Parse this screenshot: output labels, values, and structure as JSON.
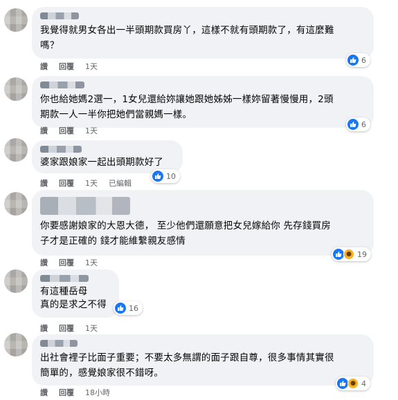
{
  "comments": [
    {
      "text": "我覺得就男女各出一半頭期款買房丫，這樣不就有頭期款了，有這麼難\n嗎？",
      "actions": [
        "讚",
        "回覆",
        "1天"
      ],
      "reaction_count": "6"
    },
    {
      "text": "你也給她媽2選一，1女兒還給妳讓她跟她姊姊一樣妳留著慢慢用，2頭\n期款一人一半你把她們當親媽一樣。",
      "actions": [
        "讚",
        "回覆",
        "1天"
      ],
      "reaction_count": "6"
    },
    {
      "text": "婆家跟娘家一起出頭期款好了",
      "actions": [
        "讚",
        "回覆",
        "1天",
        "已編輯"
      ],
      "reaction_count": "10"
    },
    {
      "text": "你要感謝娘家的大恩大德， 至少他們還願意把女兒嫁給你 先存錢買房\n子才是正確的 錢才能維繫親友感情",
      "actions": [
        "讚",
        "回覆",
        "1天"
      ],
      "reaction_count": "19"
    },
    {
      "text": "有這種岳母\n真的是求之不得",
      "actions": [
        "讚",
        "回覆",
        "1天"
      ],
      "reaction_count": "16"
    },
    {
      "text": "出社會裡子比面子重要；不要太多無謂的面子跟自尊，很多事情其實很\n簡單的，感覺娘家很不錯呀。",
      "actions": [
        "讚",
        "回覆",
        "18小時"
      ],
      "reaction_count": "4"
    }
  ],
  "icons": {
    "like": "like-thumb-icon",
    "wow": "wow-face-icon"
  },
  "colors": {
    "bubble": "#f0f2f5",
    "like": "#1877f2",
    "wow": "#f7b125",
    "meta_text": "#65676b"
  }
}
